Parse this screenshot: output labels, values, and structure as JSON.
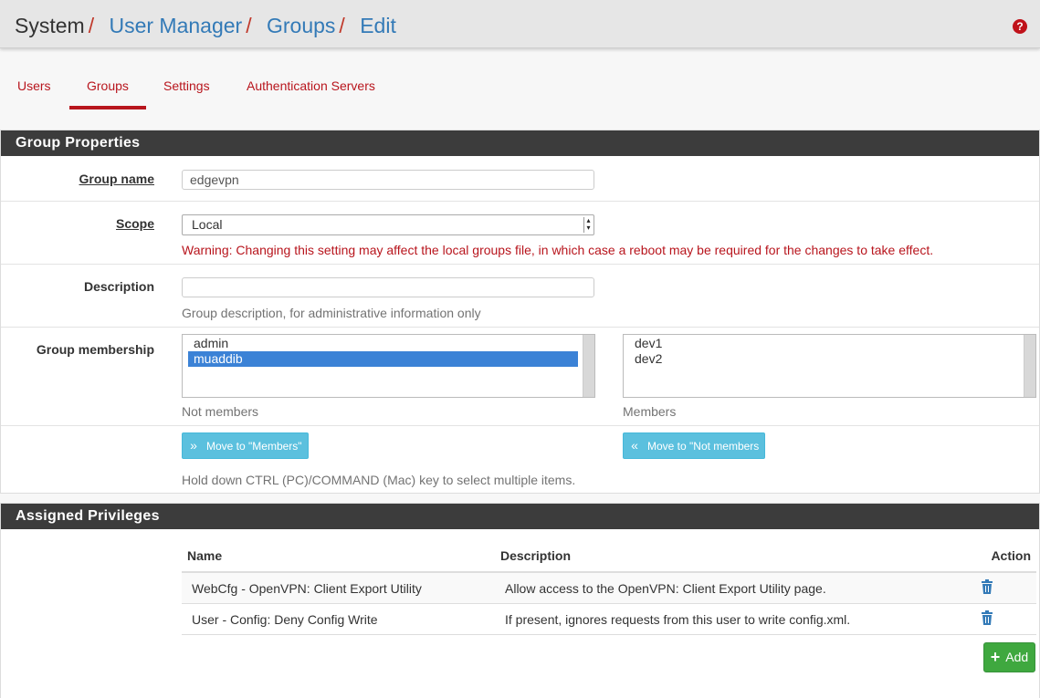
{
  "breadcrumb": [
    "System",
    "User Manager",
    "Groups",
    "Edit"
  ],
  "help_glyph": "?",
  "tabs": [
    {
      "label": "Users",
      "active": false
    },
    {
      "label": "Groups",
      "active": true
    },
    {
      "label": "Settings",
      "active": false
    },
    {
      "label": "Authentication Servers",
      "active": false
    }
  ],
  "group_properties": {
    "title": "Group Properties",
    "group_name": {
      "label": "Group name",
      "value": "edgevpn"
    },
    "scope": {
      "label": "Scope",
      "value": "Local",
      "warning": "Warning: Changing this setting may affect the local groups file, in which case a reboot may be required for the changes to take effect."
    },
    "description": {
      "label": "Description",
      "value": "",
      "help": "Group description, for administrative information only"
    },
    "membership": {
      "label": "Group membership",
      "not_members": [
        "admin",
        "muaddib"
      ],
      "not_members_selected": "muaddib",
      "members": [
        "dev1",
        "dev2"
      ],
      "not_members_caption": "Not members",
      "members_caption": "Members",
      "move_to_members": "Move to \"Members\"",
      "move_to_not_members": "Move to \"Not members",
      "help": "Hold down CTRL (PC)/COMMAND (Mac) key to select multiple items."
    }
  },
  "privileges": {
    "title": "Assigned Privileges",
    "columns": [
      "Name",
      "Description",
      "Action"
    ],
    "rows": [
      {
        "name": "WebCfg - OpenVPN: Client Export Utility",
        "description": "Allow access to the OpenVPN: Client Export Utility page."
      },
      {
        "name": "User - Config: Deny Config Write",
        "description": "If present, ignores requests from this user to write config.xml."
      }
    ],
    "add_label": "Add"
  },
  "icons": {
    "help": "help-circle-icon",
    "trash": "trash-icon",
    "add": "plus-icon",
    "right": "double-chevron-right-icon",
    "left": "double-chevron-left-icon"
  }
}
